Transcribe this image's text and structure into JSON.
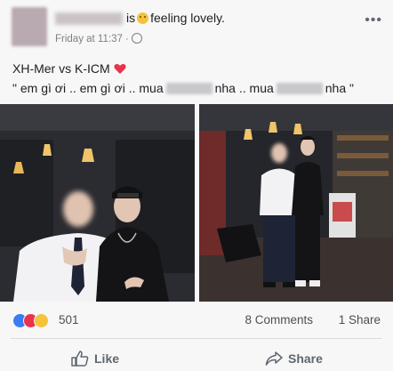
{
  "post": {
    "headline": "is",
    "feeling": "feeling lovely.",
    "timestamp": "Friday at 11:37 ·",
    "text_line1": "XH-Mer  vs K-ICM",
    "text_line2_a": "\" em gì ơi .. em gì ơi .. mua",
    "text_line2_b": "nha .. mua",
    "text_line2_c": "nha \"",
    "more": "•••"
  },
  "stats": {
    "reactions_count": "501",
    "comments": "8 Comments",
    "shares": "1 Share"
  },
  "actions": {
    "like": "Like",
    "share": "Share"
  },
  "colors": {
    "like_blue": "#3b7cf5",
    "love_red": "#e8334a",
    "haha_yellow": "#f5c33b"
  }
}
